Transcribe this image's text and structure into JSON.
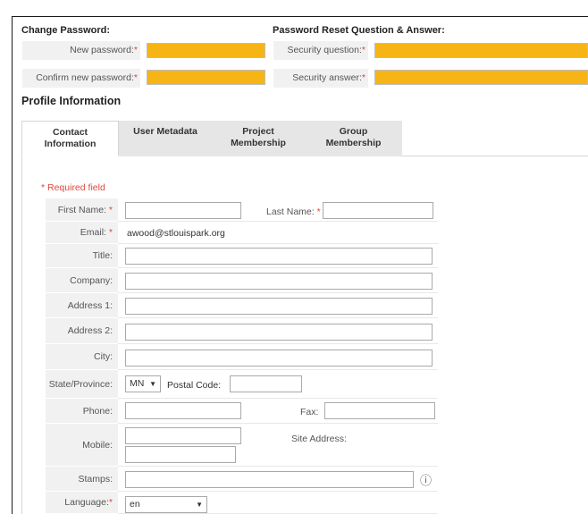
{
  "change_password": {
    "title": "Change Password:",
    "new_password_label": "New password:",
    "confirm_password_label": "Confirm new password:",
    "required_marker": "*"
  },
  "password_reset": {
    "title": "Password Reset Question & Answer:",
    "question_label": "Security question:",
    "answer_label": "Security answer:",
    "required_marker": "*"
  },
  "profile": {
    "title": "Profile Information"
  },
  "tabs": [
    {
      "label_line1": "Contact",
      "label_line2": "Information"
    },
    {
      "label_line1": "User Metadata",
      "label_line2": ""
    },
    {
      "label_line1": "Project",
      "label_line2": "Membership"
    },
    {
      "label_line1": "Group",
      "label_line2": "Membership"
    }
  ],
  "form": {
    "required_note": "* Required field",
    "required_marker": "*",
    "first_name_label": "First Name:",
    "first_name_value": "",
    "last_name_label": "Last Name:",
    "last_name_value": "",
    "email_label": "Email:",
    "email_value": "awood@stlouispark.org",
    "title_label": "Title:",
    "company_label": "Company:",
    "address1_label": "Address 1:",
    "address2_label": "Address 2:",
    "city_label": "City:",
    "state_label": "State/Province:",
    "state_value": "MN",
    "postal_label": "Postal Code:",
    "phone_label": "Phone:",
    "fax_label": "Fax:",
    "mobile_label": "Mobile:",
    "site_address_label": "Site Address:",
    "stamps_label": "Stamps:",
    "language_label": "Language:",
    "language_value": "en",
    "info_glyph": "ⓘ"
  }
}
